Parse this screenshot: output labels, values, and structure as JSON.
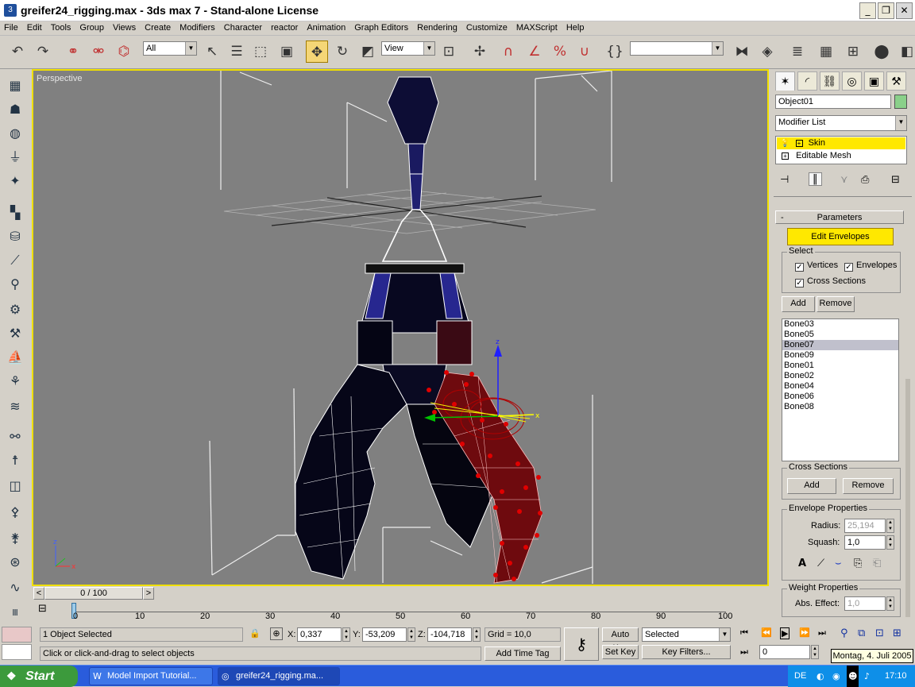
{
  "window": {
    "title": "greifer24_rigging.max - 3ds max 7  - Stand-alone License",
    "minimize_icon": "minimize-icon",
    "restore_icon": "restore-icon",
    "close_icon": "close-icon"
  },
  "menu": [
    "File",
    "Edit",
    "Tools",
    "Group",
    "Views",
    "Create",
    "Modifiers",
    "Character",
    "reactor",
    "Animation",
    "Graph Editors",
    "Rendering",
    "Customize",
    "MAXScript",
    "Help"
  ],
  "toolbar": {
    "selection_filter": "All",
    "reference_coord": "View",
    "named_selection": ""
  },
  "viewport": {
    "label": "Perspective"
  },
  "command_panel": {
    "object_name": "Object01",
    "object_color": "#8ad08a",
    "modifier_list_label": "Modifier List",
    "stack": [
      {
        "label": "Skin",
        "selected": true
      },
      {
        "label": "Editable Mesh",
        "selected": false
      }
    ],
    "rollout_title": "Parameters",
    "edit_envelopes_label": "Edit Envelopes",
    "select_group_label": "Select",
    "checkboxes": [
      {
        "label": "Vertices",
        "checked": true
      },
      {
        "label": "Envelopes",
        "checked": true
      },
      {
        "label": "Cross Sections",
        "checked": true
      }
    ],
    "add_label": "Add",
    "remove_label": "Remove",
    "bones": [
      {
        "name": "Bone03",
        "selected": false
      },
      {
        "name": "Bone05",
        "selected": false
      },
      {
        "name": "Bone07",
        "selected": true
      },
      {
        "name": "Bone09",
        "selected": false
      },
      {
        "name": "Bone01",
        "selected": false
      },
      {
        "name": "Bone02",
        "selected": false
      },
      {
        "name": "Bone04",
        "selected": false
      },
      {
        "name": "Bone06",
        "selected": false
      },
      {
        "name": "Bone08",
        "selected": false
      }
    ],
    "cross_sections_label": "Cross Sections",
    "cs_add_label": "Add",
    "cs_remove_label": "Remove",
    "envelope_props_label": "Envelope Properties",
    "radius_label": "Radius:",
    "radius_value": "25,194",
    "squash_label": "Squash:",
    "squash_value": "1,0",
    "weight_props_label": "Weight Properties",
    "abs_effect_label": "Abs. Effect:",
    "abs_effect_value": "1,0"
  },
  "timeline": {
    "frame_display": "0 / 100",
    "ticks": [
      "0",
      "10",
      "20",
      "30",
      "40",
      "50",
      "60",
      "70",
      "80",
      "90",
      "100"
    ]
  },
  "status": {
    "selection_text": "1 Object Selected",
    "prompt_text": "Click or click-and-drag to select objects",
    "x_label": "X:",
    "x_value": "0,337",
    "y_label": "Y:",
    "y_value": "-53,209",
    "z_label": "Z:",
    "z_value": "-104,718",
    "grid_text": "Grid = 10,0",
    "add_time_tag": "Add Time Tag",
    "auto_key": "Auto Key",
    "set_key": "Set Key",
    "key_mode": "Selected",
    "key_filters": "Key Filters...",
    "current_frame": "0"
  },
  "taskbar": {
    "start_label": "Start",
    "tasks": [
      {
        "label": "Model Import Tutorial...",
        "active": false
      },
      {
        "label": "greifer24_rigging.ma...",
        "active": true
      }
    ],
    "lang": "DE",
    "clock": "17:10",
    "tooltip": "Montag, 4. Juli 2005"
  }
}
